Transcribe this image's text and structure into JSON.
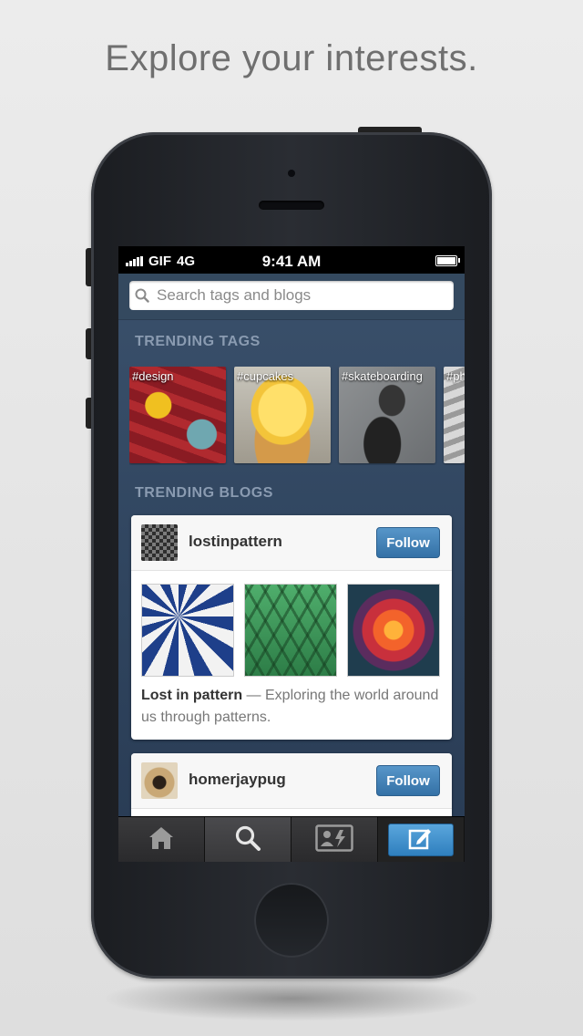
{
  "headline": "Explore your interests.",
  "status_bar": {
    "carrier": "GIF",
    "network": "4G",
    "time": "9:41 AM"
  },
  "search": {
    "placeholder": "Search tags and blogs",
    "icon": "search-icon"
  },
  "trending_tags": {
    "title": "TRENDING TAGS",
    "tags": [
      {
        "label": "#design"
      },
      {
        "label": "#cupcakes"
      },
      {
        "label": "#skateboarding"
      },
      {
        "label": "#ph"
      }
    ]
  },
  "trending_blogs": {
    "title": "TRENDING BLOGS",
    "blogs": [
      {
        "name": "lostinpattern",
        "follow_label": "Follow",
        "title": "Lost in pattern",
        "separator": " — ",
        "description": "Exploring the world around us through patterns."
      },
      {
        "name": "homerjaypug",
        "follow_label": "Follow"
      }
    ]
  },
  "tabbar": {
    "items": [
      {
        "icon": "home-icon"
      },
      {
        "icon": "search-icon",
        "active": true
      },
      {
        "icon": "activity-icon"
      },
      {
        "icon": "compose-icon"
      }
    ]
  },
  "colors": {
    "accent": "#3f85c0",
    "app_background": "#34495f",
    "section_title": "#8a9bb1"
  }
}
